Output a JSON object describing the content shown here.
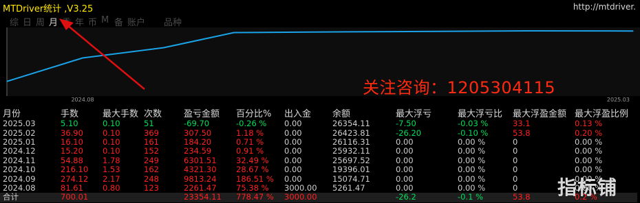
{
  "window": {
    "title": "MTDriver统计 ,V3.25",
    "url": "http://mtdriver."
  },
  "tabs": [
    {
      "label": "综",
      "active": false
    },
    {
      "label": "日",
      "active": false
    },
    {
      "label": "周",
      "active": false
    },
    {
      "label": "月",
      "active": true
    },
    {
      "label": "季",
      "active": false
    },
    {
      "label": "年",
      "active": false
    },
    {
      "label": "币",
      "active": false
    },
    {
      "label": "M",
      "active": false
    },
    {
      "label": "备",
      "active": false
    },
    {
      "label": "账户",
      "active": false
    },
    {
      "label": "品种",
      "active": false
    }
  ],
  "promo_text": "关注咨询：1205304115",
  "watermark_text": "指标铺",
  "chart_data": {
    "type": "line",
    "x": [
      "2024.08",
      "2024.09",
      "2024.10",
      "2024.11",
      "2024.12",
      "2025.01",
      "2025.02",
      "2025.03"
    ],
    "x_tick_labels": [
      "2024.08",
      "2025.03"
    ],
    "series": [
      {
        "values": [
          5261.47,
          15074.71,
          19396.01,
          25697.52,
          25932.11,
          26116.31,
          26423.81,
          26354.11
        ],
        "color": "#1aa3e8"
      }
    ],
    "grid": false,
    "background": "#0d0d0d"
  },
  "table": {
    "headers": [
      "月份",
      "手数",
      "最大手数",
      "次数",
      "盈亏金额",
      "百分比%",
      "出入金",
      "余额",
      "最大浮亏",
      "最大浮亏比",
      "最大浮盈金额",
      "最大浮盈比例"
    ],
    "rows": [
      {
        "month": "2025.03",
        "lots": "5.10",
        "maxlot": "0.10",
        "count": "51",
        "amount": "-69.70",
        "pct": "-0.26 %",
        "deposit": "0.00",
        "balance": "26354.11",
        "dd": "-7.50",
        "ddp": "-0.03 %",
        "mfa": "33.1",
        "mfp": "0.13 %",
        "color": "g"
      },
      {
        "month": "2025.02",
        "lots": "36.90",
        "maxlot": "0.10",
        "count": "369",
        "amount": "307.50",
        "pct": "1.18 %",
        "deposit": "0.00",
        "balance": "26423.81",
        "dd": "-26.20",
        "ddp": "-0.10 %",
        "mfa": "53.8",
        "mfp": "0.20 %",
        "color": "r"
      },
      {
        "month": "2025.01",
        "lots": "16.10",
        "maxlot": "0.10",
        "count": "161",
        "amount": "184.20",
        "pct": "0.71 %",
        "deposit": "0.00",
        "balance": "26116.31",
        "dd": "0.00",
        "ddp": "0.00 %",
        "mfa": "0",
        "mfp": "0.00 %",
        "color": "r"
      },
      {
        "month": "2024.12",
        "lots": "15.20",
        "maxlot": "0.10",
        "count": "152",
        "amount": "234.59",
        "pct": "0.91 %",
        "deposit": "0.00",
        "balance": "25932.11",
        "dd": "0.00",
        "ddp": "0.00 %",
        "mfa": "0",
        "mfp": "0.00 %",
        "color": "r"
      },
      {
        "month": "2024.11",
        "lots": "54.88",
        "maxlot": "1.78",
        "count": "249",
        "amount": "6301.51",
        "pct": "32.49 %",
        "deposit": "0.00",
        "balance": "25697.52",
        "dd": "0.00",
        "ddp": "0.00 %",
        "mfa": "0",
        "mfp": "0.00 %",
        "color": "r"
      },
      {
        "month": "2024.10",
        "lots": "216.10",
        "maxlot": "1.53",
        "count": "162",
        "amount": "4321.30",
        "pct": "28.67 %",
        "deposit": "0.00",
        "balance": "19396.01",
        "dd": "0.00",
        "ddp": "0.00 %",
        "mfa": "0",
        "mfp": "0.00 %",
        "color": "r"
      },
      {
        "month": "2024.09",
        "lots": "274.12",
        "maxlot": "2.17",
        "count": "248",
        "amount": "9813.24",
        "pct": "186.51 %",
        "deposit": "0.00",
        "balance": "15074.71",
        "dd": "0.00",
        "ddp": "0.00 %",
        "mfa": "0",
        "mfp": "0.00 %",
        "color": "r"
      },
      {
        "month": "2024.08",
        "lots": "81.61",
        "maxlot": "0.80",
        "count": "123",
        "amount": "2261.47",
        "pct": "75.38 %",
        "deposit": "3000.00",
        "balance": "5261.47",
        "dd": "0.00",
        "ddp": "0.00 %",
        "mfa": "0",
        "mfp": "0.00 %",
        "color": "r"
      }
    ],
    "total": {
      "month": "合计",
      "lots": "700.01",
      "maxlot": "",
      "count": "",
      "amount": "23354.11",
      "pct": "778.47 %",
      "deposit": "3000.00",
      "balance": "",
      "dd": "-26.2",
      "ddp": "-0.1 %",
      "mfa": "53.8",
      "mfp": "0.2 %"
    }
  },
  "colors": {
    "title": "#ffe600",
    "profit_red": "#ff2020",
    "loss_green": "#00e05a",
    "line": "#1aa3e8",
    "promo": "#ff2a10"
  }
}
